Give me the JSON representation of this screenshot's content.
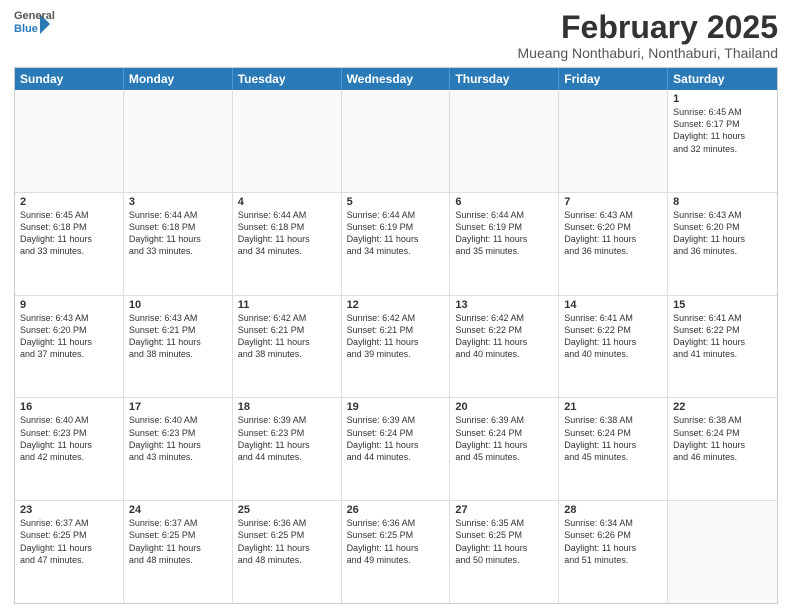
{
  "header": {
    "logo_general": "General",
    "logo_blue": "Blue",
    "month_title": "February 2025",
    "location": "Mueang Nonthaburi, Nonthaburi, Thailand"
  },
  "days_of_week": [
    "Sunday",
    "Monday",
    "Tuesday",
    "Wednesday",
    "Thursday",
    "Friday",
    "Saturday"
  ],
  "weeks": [
    [
      {
        "day": "",
        "text": "",
        "empty": true
      },
      {
        "day": "",
        "text": "",
        "empty": true
      },
      {
        "day": "",
        "text": "",
        "empty": true
      },
      {
        "day": "",
        "text": "",
        "empty": true
      },
      {
        "day": "",
        "text": "",
        "empty": true
      },
      {
        "day": "",
        "text": "",
        "empty": true
      },
      {
        "day": "1",
        "text": "Sunrise: 6:45 AM\nSunset: 6:17 PM\nDaylight: 11 hours\nand 32 minutes.",
        "empty": false
      }
    ],
    [
      {
        "day": "2",
        "text": "Sunrise: 6:45 AM\nSunset: 6:18 PM\nDaylight: 11 hours\nand 33 minutes.",
        "empty": false
      },
      {
        "day": "3",
        "text": "Sunrise: 6:44 AM\nSunset: 6:18 PM\nDaylight: 11 hours\nand 33 minutes.",
        "empty": false
      },
      {
        "day": "4",
        "text": "Sunrise: 6:44 AM\nSunset: 6:18 PM\nDaylight: 11 hours\nand 34 minutes.",
        "empty": false
      },
      {
        "day": "5",
        "text": "Sunrise: 6:44 AM\nSunset: 6:19 PM\nDaylight: 11 hours\nand 34 minutes.",
        "empty": false
      },
      {
        "day": "6",
        "text": "Sunrise: 6:44 AM\nSunset: 6:19 PM\nDaylight: 11 hours\nand 35 minutes.",
        "empty": false
      },
      {
        "day": "7",
        "text": "Sunrise: 6:43 AM\nSunset: 6:20 PM\nDaylight: 11 hours\nand 36 minutes.",
        "empty": false
      },
      {
        "day": "8",
        "text": "Sunrise: 6:43 AM\nSunset: 6:20 PM\nDaylight: 11 hours\nand 36 minutes.",
        "empty": false
      }
    ],
    [
      {
        "day": "9",
        "text": "Sunrise: 6:43 AM\nSunset: 6:20 PM\nDaylight: 11 hours\nand 37 minutes.",
        "empty": false
      },
      {
        "day": "10",
        "text": "Sunrise: 6:43 AM\nSunset: 6:21 PM\nDaylight: 11 hours\nand 38 minutes.",
        "empty": false
      },
      {
        "day": "11",
        "text": "Sunrise: 6:42 AM\nSunset: 6:21 PM\nDaylight: 11 hours\nand 38 minutes.",
        "empty": false
      },
      {
        "day": "12",
        "text": "Sunrise: 6:42 AM\nSunset: 6:21 PM\nDaylight: 11 hours\nand 39 minutes.",
        "empty": false
      },
      {
        "day": "13",
        "text": "Sunrise: 6:42 AM\nSunset: 6:22 PM\nDaylight: 11 hours\nand 40 minutes.",
        "empty": false
      },
      {
        "day": "14",
        "text": "Sunrise: 6:41 AM\nSunset: 6:22 PM\nDaylight: 11 hours\nand 40 minutes.",
        "empty": false
      },
      {
        "day": "15",
        "text": "Sunrise: 6:41 AM\nSunset: 6:22 PM\nDaylight: 11 hours\nand 41 minutes.",
        "empty": false
      }
    ],
    [
      {
        "day": "16",
        "text": "Sunrise: 6:40 AM\nSunset: 6:23 PM\nDaylight: 11 hours\nand 42 minutes.",
        "empty": false
      },
      {
        "day": "17",
        "text": "Sunrise: 6:40 AM\nSunset: 6:23 PM\nDaylight: 11 hours\nand 43 minutes.",
        "empty": false
      },
      {
        "day": "18",
        "text": "Sunrise: 6:39 AM\nSunset: 6:23 PM\nDaylight: 11 hours\nand 44 minutes.",
        "empty": false
      },
      {
        "day": "19",
        "text": "Sunrise: 6:39 AM\nSunset: 6:24 PM\nDaylight: 11 hours\nand 44 minutes.",
        "empty": false
      },
      {
        "day": "20",
        "text": "Sunrise: 6:39 AM\nSunset: 6:24 PM\nDaylight: 11 hours\nand 45 minutes.",
        "empty": false
      },
      {
        "day": "21",
        "text": "Sunrise: 6:38 AM\nSunset: 6:24 PM\nDaylight: 11 hours\nand 45 minutes.",
        "empty": false
      },
      {
        "day": "22",
        "text": "Sunrise: 6:38 AM\nSunset: 6:24 PM\nDaylight: 11 hours\nand 46 minutes.",
        "empty": false
      }
    ],
    [
      {
        "day": "23",
        "text": "Sunrise: 6:37 AM\nSunset: 6:25 PM\nDaylight: 11 hours\nand 47 minutes.",
        "empty": false
      },
      {
        "day": "24",
        "text": "Sunrise: 6:37 AM\nSunset: 6:25 PM\nDaylight: 11 hours\nand 48 minutes.",
        "empty": false
      },
      {
        "day": "25",
        "text": "Sunrise: 6:36 AM\nSunset: 6:25 PM\nDaylight: 11 hours\nand 48 minutes.",
        "empty": false
      },
      {
        "day": "26",
        "text": "Sunrise: 6:36 AM\nSunset: 6:25 PM\nDaylight: 11 hours\nand 49 minutes.",
        "empty": false
      },
      {
        "day": "27",
        "text": "Sunrise: 6:35 AM\nSunset: 6:25 PM\nDaylight: 11 hours\nand 50 minutes.",
        "empty": false
      },
      {
        "day": "28",
        "text": "Sunrise: 6:34 AM\nSunset: 6:26 PM\nDaylight: 11 hours\nand 51 minutes.",
        "empty": false
      },
      {
        "day": "",
        "text": "",
        "empty": true
      }
    ]
  ]
}
